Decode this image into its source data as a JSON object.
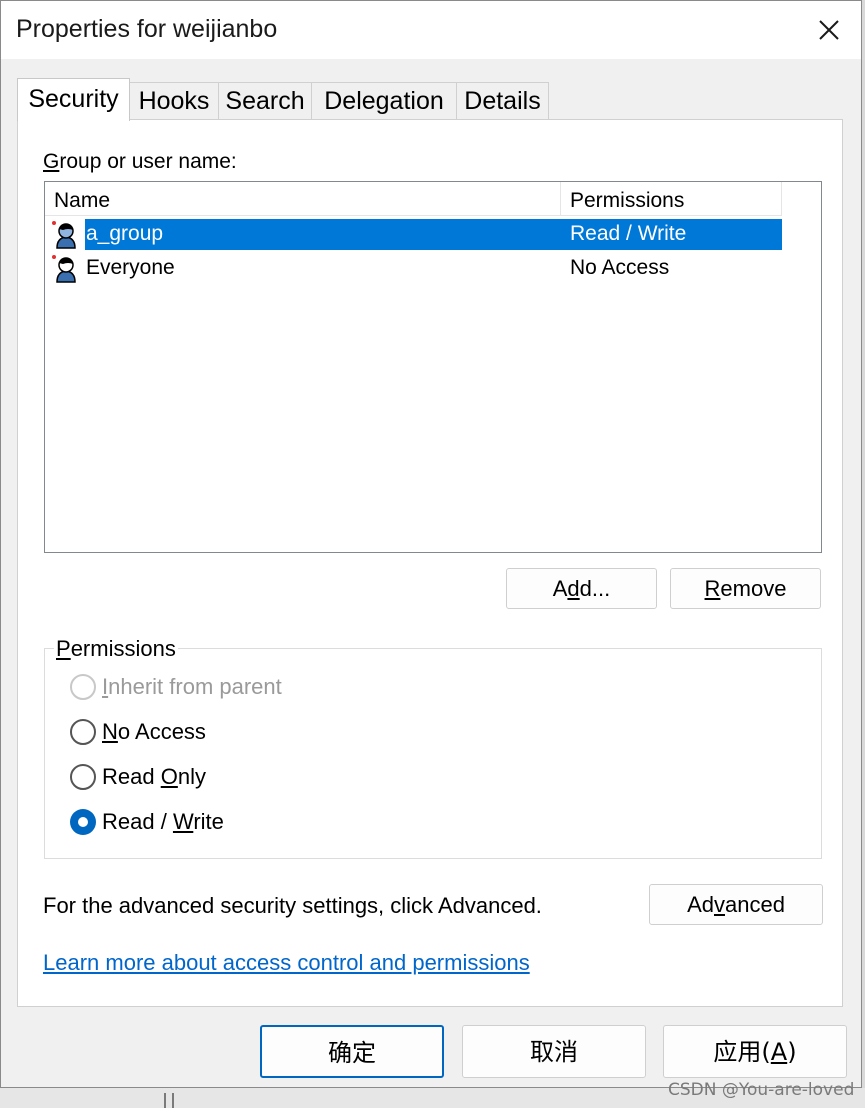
{
  "window": {
    "title": "Properties for weijianbo",
    "close_glyph": "✕"
  },
  "tabs": [
    {
      "label": "Security",
      "active": true
    },
    {
      "label": "Hooks"
    },
    {
      "label": "Search"
    },
    {
      "label": "Delegation"
    },
    {
      "label": "Details"
    }
  ],
  "security": {
    "group_label_mnemonic": "G",
    "group_label_rest": "roup or user name:",
    "columns": {
      "name": "Name",
      "permissions": "Permissions"
    },
    "entries": [
      {
        "name": "a_group",
        "permission": "Read / Write",
        "selected": true,
        "icon": "user-group-icon"
      },
      {
        "name": "Everyone",
        "permission": "No Access",
        "icon": "user-group-icon"
      }
    ],
    "add_button": {
      "pre": "A",
      "mnemonic": "d",
      "post": "d..."
    },
    "remove_button": {
      "mnemonic": "R",
      "post": "emove"
    },
    "permissions_title": {
      "mnemonic": "P",
      "post": "ermissions"
    },
    "options": [
      {
        "pre": "",
        "mnemonic": "I",
        "post": "nherit from parent",
        "disabled": true
      },
      {
        "pre": "",
        "mnemonic": "N",
        "post": "o Access"
      },
      {
        "pre": "Read ",
        "mnemonic": "O",
        "post": "nly"
      },
      {
        "pre": "Read / ",
        "mnemonic": "W",
        "post": "rite",
        "checked": true
      }
    ],
    "advanced_text": "For the advanced security settings, click Advanced.",
    "advanced_button": {
      "pre": "Ad",
      "mnemonic": "v",
      "post": "anced"
    },
    "learn_more_link": "Learn more about access control and permissions"
  },
  "footer": {
    "ok": "确定",
    "cancel": "取消",
    "apply_pre": "应用(",
    "apply_mnemonic": "A",
    "apply_post": ")"
  },
  "watermark": "CSDN @You-are-loved",
  "colors": {
    "selection": "#0078d7",
    "accent": "#0067c0",
    "link": "#0066cc"
  }
}
